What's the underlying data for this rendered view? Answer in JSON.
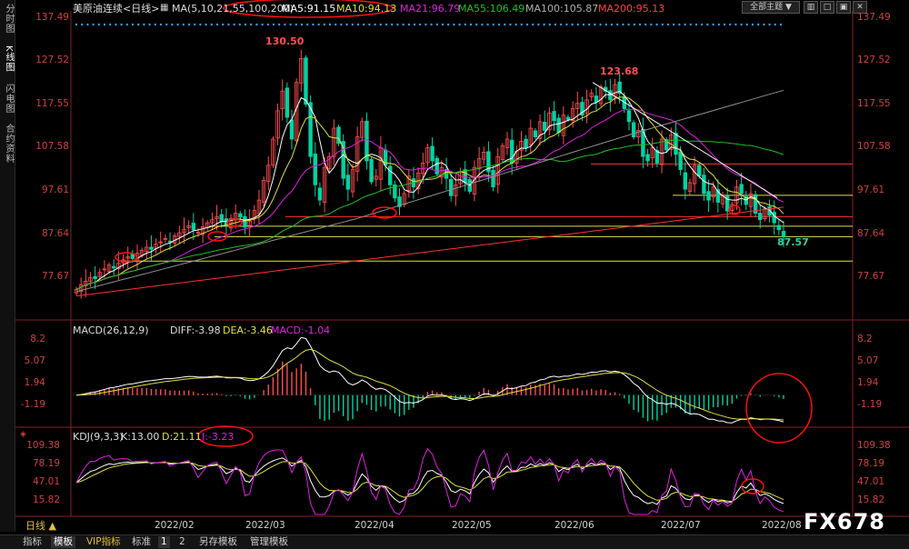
{
  "sidebar": {
    "items": [
      {
        "label": "分时图",
        "active": false
      },
      {
        "label": "K线图",
        "active": true
      },
      {
        "label": "闪电图",
        "active": false
      },
      {
        "label": "合约资料",
        "active": false
      }
    ]
  },
  "header": {
    "title": "美原油连续<日线>",
    "ma_params": "MA(5,10,21,55,100,200)",
    "ma5": "MA5:91.15",
    "ma10": "MA10:94.13",
    "ma21": "MA21:96.79",
    "ma55": "MA55:106.49",
    "ma100": "MA100:105.87",
    "ma200": "MA200:95.13",
    "theme_button": "全部主题"
  },
  "macd_header": {
    "params": "MACD(26,12,9)",
    "diff": "DIFF:-3.98",
    "dea": "DEA:-3.46",
    "macd": "MACD:-1.04"
  },
  "kdj_header": {
    "params": "KDJ(9,3,3)",
    "k": "K:13.00",
    "d": "D:21.11",
    "j": "J:-3.23"
  },
  "annotations": {
    "high1": "130.50",
    "high2": "123.68",
    "low": "87.57"
  },
  "bottom_bar": {
    "period": "日线 ▲",
    "tabs": [
      "指标",
      "模板",
      "VIP指标",
      "标准",
      "1",
      "2",
      "另存模板",
      "管理模板"
    ],
    "active_tab": "模板"
  },
  "watermark": "FX678",
  "colors": {
    "up": "#ff4d4d",
    "down": "#00d3a3",
    "ma5": "#ffffff",
    "ma10": "#e0e040",
    "ma21": "#e020e0",
    "ma55": "#20c020",
    "ma100": "#909090",
    "ma200": "#ff3030",
    "axis": "#d04040"
  },
  "chart_data": [
    {
      "type": "candlestick",
      "title": "美原油连续<日线>",
      "y_ticks": [
        137.49,
        127.52,
        117.55,
        107.58,
        97.61,
        87.64,
        77.67
      ],
      "ylim": [
        71,
        139
      ],
      "x_ticks": [
        "2022/02",
        "2022/03",
        "2022/04",
        "2022/05",
        "2022/06",
        "2022/07",
        "2022/08"
      ],
      "closes": [
        75.5,
        76.6,
        77.4,
        78.2,
        78.0,
        79.4,
        80.2,
        81.1,
        80.4,
        81.5,
        82.3,
        83.0,
        82.6,
        83.8,
        84.5,
        85.2,
        84.7,
        85.9,
        86.4,
        87.2,
        86.5,
        87.8,
        88.5,
        89.3,
        90.1,
        89.2,
        88.6,
        89.9,
        90.8,
        91.5,
        92.2,
        91.0,
        90.2,
        91.8,
        93.0,
        92.1,
        89.8,
        91.2,
        93.6,
        96.0,
        100.5,
        104.0,
        110.0,
        116.5,
        121.0,
        115.0,
        110.0,
        123.0,
        128.5,
        118.0,
        106.0,
        99.5,
        96.0,
        103.5,
        106.0,
        112.5,
        109.0,
        101.0,
        98.5,
        103.0,
        110.5,
        114.0,
        105.0,
        100.2,
        101.5,
        108.0,
        104.0,
        99.5,
        96.5,
        94.5,
        97.5,
        101.5,
        99.0,
        102.2,
        104.5,
        108.0,
        105.0,
        102.0,
        103.5,
        101.0,
        97.0,
        99.5,
        102.5,
        100.0,
        98.0,
        103.5,
        105.5,
        107.0,
        102.5,
        99.0,
        106.0,
        108.5,
        110.0,
        104.5,
        107.2,
        109.5,
        108.0,
        112.5,
        110.5,
        114.0,
        112.0,
        116.0,
        114.2,
        111.5,
        115.5,
        114.5,
        117.0,
        118.2,
        115.5,
        119.0,
        120.5,
        118.5,
        122.0,
        121.0,
        119.0,
        122.5,
        120.5,
        117.0,
        114.0,
        110.5,
        112.0,
        106.0,
        105.0,
        108.0,
        104.5,
        110.0,
        107.5,
        111.0,
        106.5,
        103.0,
        98.5,
        100.0,
        104.0,
        101.5,
        97.5,
        96.0,
        99.0,
        95.5,
        97.0,
        93.5,
        95.0,
        99.0,
        97.5,
        95.0,
        97.5,
        93.0,
        91.5,
        94.0,
        92.5,
        90.8,
        89.2,
        87.57
      ],
      "annotated_high_1": 130.5,
      "annotated_high_2": 123.68,
      "annotated_low": 87.57,
      "last_ma": {
        "MA5": 91.15,
        "MA10": 94.13,
        "MA21": 96.79,
        "MA55": 106.49,
        "MA100": 105.87,
        "MA200": 95.13
      },
      "horizontal_levels": [
        {
          "value": 104.3,
          "color": "#ff3030"
        },
        {
          "value": 97.1,
          "color": "#e0e040"
        },
        {
          "value": 92.2,
          "color": "#ff3030"
        },
        {
          "value": 90.0,
          "color": "#e0e040"
        },
        {
          "value": 87.6,
          "color": "#e0e040"
        },
        {
          "value": 82.0,
          "color": "#e0e040"
        }
      ]
    },
    {
      "type": "bar",
      "title": "MACD(26,12,9)",
      "y_ticks": [
        8.2,
        5.07,
        1.94,
        -1.19
      ],
      "ylim": [
        -4.8,
        9.6
      ],
      "last": {
        "DIFF": -3.98,
        "DEA": -3.46,
        "MACD": -1.04
      }
    },
    {
      "type": "line",
      "title": "KDJ(9,3,3)",
      "y_ticks": [
        109.38,
        78.19,
        47.01,
        15.82
      ],
      "ylim": [
        -6,
        125
      ],
      "last": {
        "K": 13.0,
        "D": 21.11,
        "J": -3.23
      }
    }
  ]
}
